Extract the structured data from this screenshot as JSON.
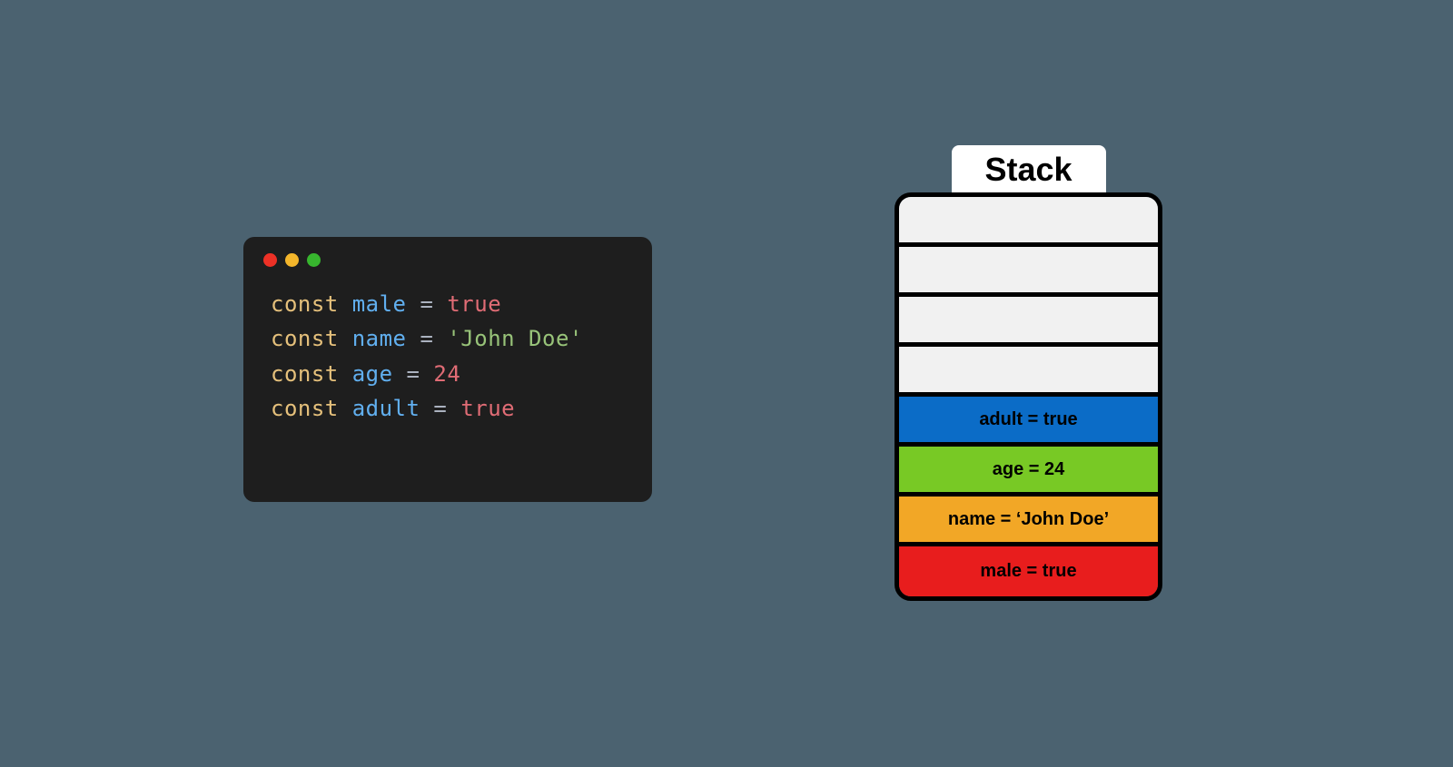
{
  "code": {
    "lines": [
      {
        "kw": "const",
        "id": "male",
        "op": " = ",
        "val": "true",
        "val_kind": "val"
      },
      {
        "kw": "const",
        "id": "name",
        "op": " = ",
        "val": "'John Doe'",
        "val_kind": "str"
      },
      {
        "kw": "const",
        "id": "age",
        "op": " = ",
        "val": "24",
        "val_kind": "val"
      },
      {
        "kw": "const",
        "id": "adult",
        "op": " = ",
        "val": "true",
        "val_kind": "val"
      }
    ]
  },
  "stack": {
    "title": "Stack",
    "slots": [
      {
        "label": "",
        "color": "empty"
      },
      {
        "label": "",
        "color": "empty"
      },
      {
        "label": "",
        "color": "empty"
      },
      {
        "label": "",
        "color": "empty"
      },
      {
        "label": "adult = true",
        "color": "blue"
      },
      {
        "label": "age = 24",
        "color": "green"
      },
      {
        "label": "name = ‘John Doe’",
        "color": "orange"
      },
      {
        "label": "male = true",
        "color": "red"
      }
    ]
  }
}
